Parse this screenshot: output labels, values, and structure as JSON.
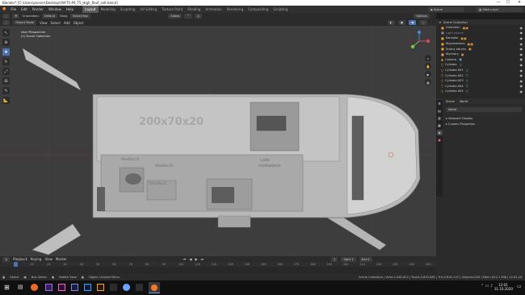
{
  "window": {
    "title": "Blender* [C:\\Users\\pionier\\Desktop\\VW-T5-P4_T5_High_Roof_seK.blend]",
    "minimize": "—",
    "maximize": "☐",
    "close": "✕"
  },
  "menubar": {
    "items": [
      "File",
      "Edit",
      "Render",
      "Window",
      "Help"
    ],
    "workspaces": [
      "Layout",
      "Modeling",
      "Sculpting",
      "UV Editing",
      "Texture Paint",
      "Shading",
      "Animation",
      "Rendering",
      "Compositing",
      "Scripting"
    ],
    "active_workspace": "Layout",
    "scene_label": "Scene",
    "viewlayer_label": "View Layer"
  },
  "tool_header": {
    "orientation_label": "Orientation:",
    "orientation_value": "Default",
    "drag_label": "Drag:",
    "drag_value": "Select Box",
    "transform_value": "Global",
    "options_label": "Options"
  },
  "view_header": {
    "mode": "Object Mode",
    "menus": [
      "View",
      "Select",
      "Add",
      "Object"
    ]
  },
  "viewport": {
    "info_line1": "User Perspective",
    "info_line2": "(1) Scene Collection",
    "annotations": {
      "main": "200x70x20",
      "left_a": "60x60x15",
      "left_b": "60x60x20",
      "left_c": "50x30x15",
      "right_a": "Lodo",
      "right_b": "rozkładane"
    }
  },
  "outliner": {
    "header": "Scene Collection",
    "rows": [
      {
        "name": "Collection",
        "icons": "▣▣"
      },
      {
        "name": "Light source",
        "icons": ""
      },
      {
        "name": "Kanapka",
        "icons": "▣▣"
      },
      {
        "name": "Wyposazenie",
        "icons": "▣▣"
      },
      {
        "name": "Ściany obrysu",
        "icons": "▣"
      },
      {
        "name": "Wymiary",
        "icons": "▣"
      },
      {
        "name": "Camera",
        "icons": "▣"
      },
      {
        "name": "Cylinder",
        "icons": "▽"
      },
      {
        "name": "Cylinder.001",
        "icons": "▽"
      },
      {
        "name": "Cylinder.002",
        "icons": "▽"
      },
      {
        "name": "Cylinder.003",
        "icons": "▽"
      },
      {
        "name": "Cylinder.004",
        "icons": "▽"
      },
      {
        "name": "Cylinder.005",
        "icons": "▽"
      }
    ]
  },
  "properties": {
    "tabs": [
      "Scene",
      "World"
    ],
    "world_field": "World",
    "sections": [
      "Viewport Display",
      "Custom Properties"
    ]
  },
  "timeline": {
    "menus": [
      "Playback",
      "Keying",
      "View",
      "Marker"
    ],
    "current_frame": "1",
    "start_label": "Start",
    "start_value": "1",
    "end_label": "End",
    "end_value": "1",
    "ticks": [
      "0",
      "10",
      "20",
      "30",
      "40",
      "50",
      "60",
      "70",
      "80",
      "90",
      "100",
      "110",
      "120",
      "130",
      "140",
      "150",
      "160",
      "170",
      "180",
      "190",
      "200",
      "210",
      "220",
      "230",
      "240",
      "250"
    ]
  },
  "status": {
    "select": "Select",
    "box_select": "Box Select",
    "rotate": "Rotate View",
    "context_menu": "Object Context Menu",
    "stats": "Scene Collection | Verts:1,482,611 | Faces:2,803,681 | Tris:2,842,147 | Objects:0/35 | Mem: 612.1 MiB | v2.81.16"
  },
  "taskbar": {
    "time": "12:01",
    "date": "31.10.2020"
  },
  "colors": {
    "accent": "#4772b3",
    "object_orange": "#e89c3b",
    "data_green": "#72c28f"
  }
}
